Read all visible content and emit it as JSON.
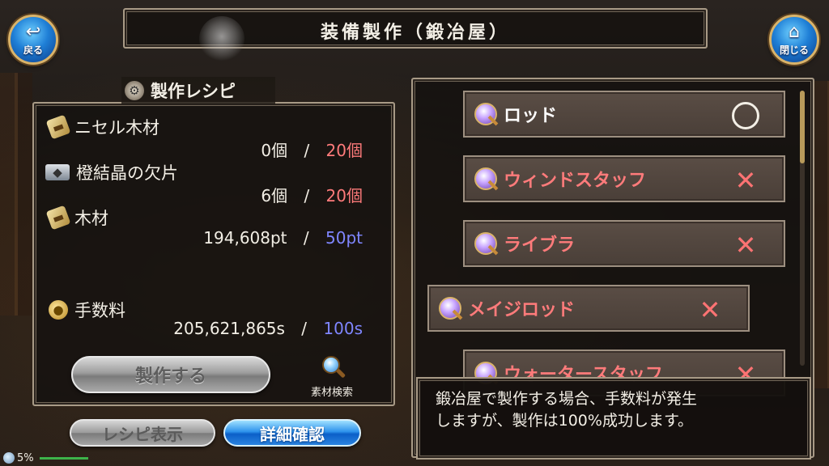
{
  "header": {
    "title": "装備製作（鍛冶屋）"
  },
  "back_button": {
    "label": "戻る",
    "icon": "back-arrow-icon"
  },
  "close_button": {
    "label": "閉じる",
    "icon": "home-icon"
  },
  "recipe": {
    "title": "製作レシピ",
    "materials": [
      {
        "name": "ニセル木材",
        "owned": "0個",
        "separator": "/",
        "required": "20個",
        "icon": "wood-icon"
      },
      {
        "name": "橙結晶の欠片",
        "owned": "6個",
        "separator": "/",
        "required": "20個",
        "icon": "crystal-icon"
      },
      {
        "name": "木材",
        "owned": "194,608pt",
        "separator": "/",
        "required": "50pt",
        "icon": "wood-icon"
      }
    ],
    "fee": {
      "name": "手数料",
      "owned": "205,621,865s",
      "separator": "/",
      "required": "100s",
      "icon": "coins-icon"
    },
    "craft_label": "製作する",
    "search_label": "素材検索"
  },
  "footer_buttons": {
    "recipe_view": "レシピ表示",
    "detail": "詳細確認"
  },
  "recipe_list": [
    {
      "name": "ロッド",
      "status": "○",
      "color": "#ffffff"
    },
    {
      "name": "ウィンドスタッフ",
      "status": "✕",
      "color": "#ff7b7b"
    },
    {
      "name": "ライブラ",
      "status": "✕",
      "color": "#ff7b7b"
    },
    {
      "name": "メイジロッド",
      "status": "✕",
      "color": "#ff7b7b"
    },
    {
      "name": "ウォータースタッフ",
      "status": "✕",
      "color": "#ff7b7b"
    }
  ],
  "message": {
    "line1": "鍛冶屋で製作する場合、手数料が発生",
    "line2": "しますが、製作は100%成功します。"
  },
  "status": {
    "percent": "5%"
  },
  "colors": {
    "need_red": "#ff7b7b",
    "need_blue": "#7f86ff",
    "accent_blue": "#2e93ec"
  }
}
